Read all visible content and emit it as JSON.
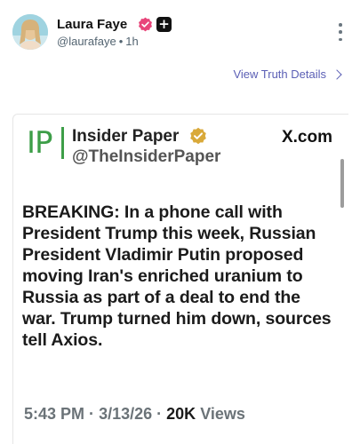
{
  "post": {
    "author_name": "Laura Faye",
    "handle": "@laurafaye",
    "dot": "•",
    "time": "1h",
    "view_details_label": "View Truth Details"
  },
  "embed": {
    "logo_text": "IP",
    "source_name": "Insider Paper",
    "source_handle": "@TheInsiderPaper",
    "site": "X.com",
    "headline": "BREAKING: In a phone call with President Trump this week, Russian President Vladimir Putin proposed moving Iran's enriched uranium to Russia as part of a deal to end the war. Trump turned him down, sources tell Axios.",
    "time": "5:43 PM",
    "sep": "·",
    "date": "3/13/26",
    "views": "20K",
    "views_label": "Views"
  },
  "colors": {
    "accent_link": "#5b5fb5",
    "verified_badge": "#e8457a",
    "logo_green": "#3d9e48",
    "gold_badge": "#d9a93a"
  },
  "icons": [
    "verified-badge-icon",
    "plus-badge-icon",
    "more-options-icon",
    "chevron-right-icon",
    "gold-verified-icon"
  ]
}
